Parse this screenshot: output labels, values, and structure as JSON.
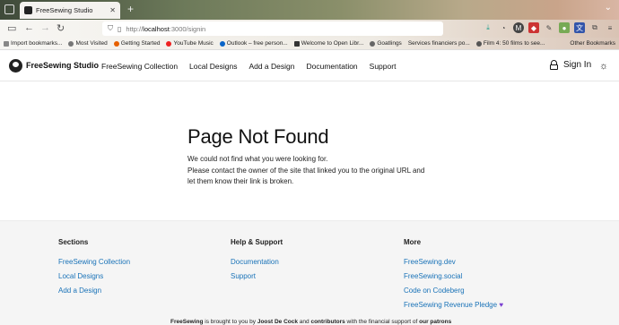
{
  "browser": {
    "tab_title": "FreeSewing Studio",
    "url_host": "localhost",
    "url_prefix": "http://",
    "url_suffix": ":3000/signin",
    "bookmarks": [
      "Import bookmarks...",
      "Most Visited",
      "Getting Started",
      "YouTube Music",
      "Outlook – free person...",
      "Welcome to Open Libr...",
      "Goatlings",
      "Services financiers po...",
      "Film 4: 50 films to see..."
    ],
    "other_bookmarks": "Other Bookmarks"
  },
  "header": {
    "brand": "FreeSewing Studio",
    "menu": [
      "FreeSewing Collection",
      "Local Designs",
      "Add a Design",
      "Documentation",
      "Support"
    ],
    "signin": "Sign In"
  },
  "main": {
    "title": "Page Not Found",
    "line1": "We could not find what you were looking for.",
    "line2": "Please contact the owner of the site that linked you to the original URL and",
    "line3": "let them know their link is broken."
  },
  "footer": {
    "sections": {
      "heading": "Sections",
      "links": [
        "FreeSewing Collection",
        "Local Designs",
        "Add a Design"
      ]
    },
    "help": {
      "heading": "Help & Support",
      "links": [
        "Documentation",
        "Support"
      ]
    },
    "more": {
      "heading": "More",
      "links": [
        "FreeSewing.dev",
        "FreeSewing.social",
        "Code on Codeberg",
        "FreeSewing Revenue Pledge"
      ]
    },
    "credits": {
      "brand": "FreeSewing",
      "text1": " is brought to you by ",
      "author": "Joost De Cock",
      "text2": " and ",
      "contrib": "contributors",
      "text3": " with the financial support of ",
      "patrons": "our patrons"
    }
  },
  "colors": {
    "link": "#1a73b8",
    "heart": "#7a3fd1"
  }
}
